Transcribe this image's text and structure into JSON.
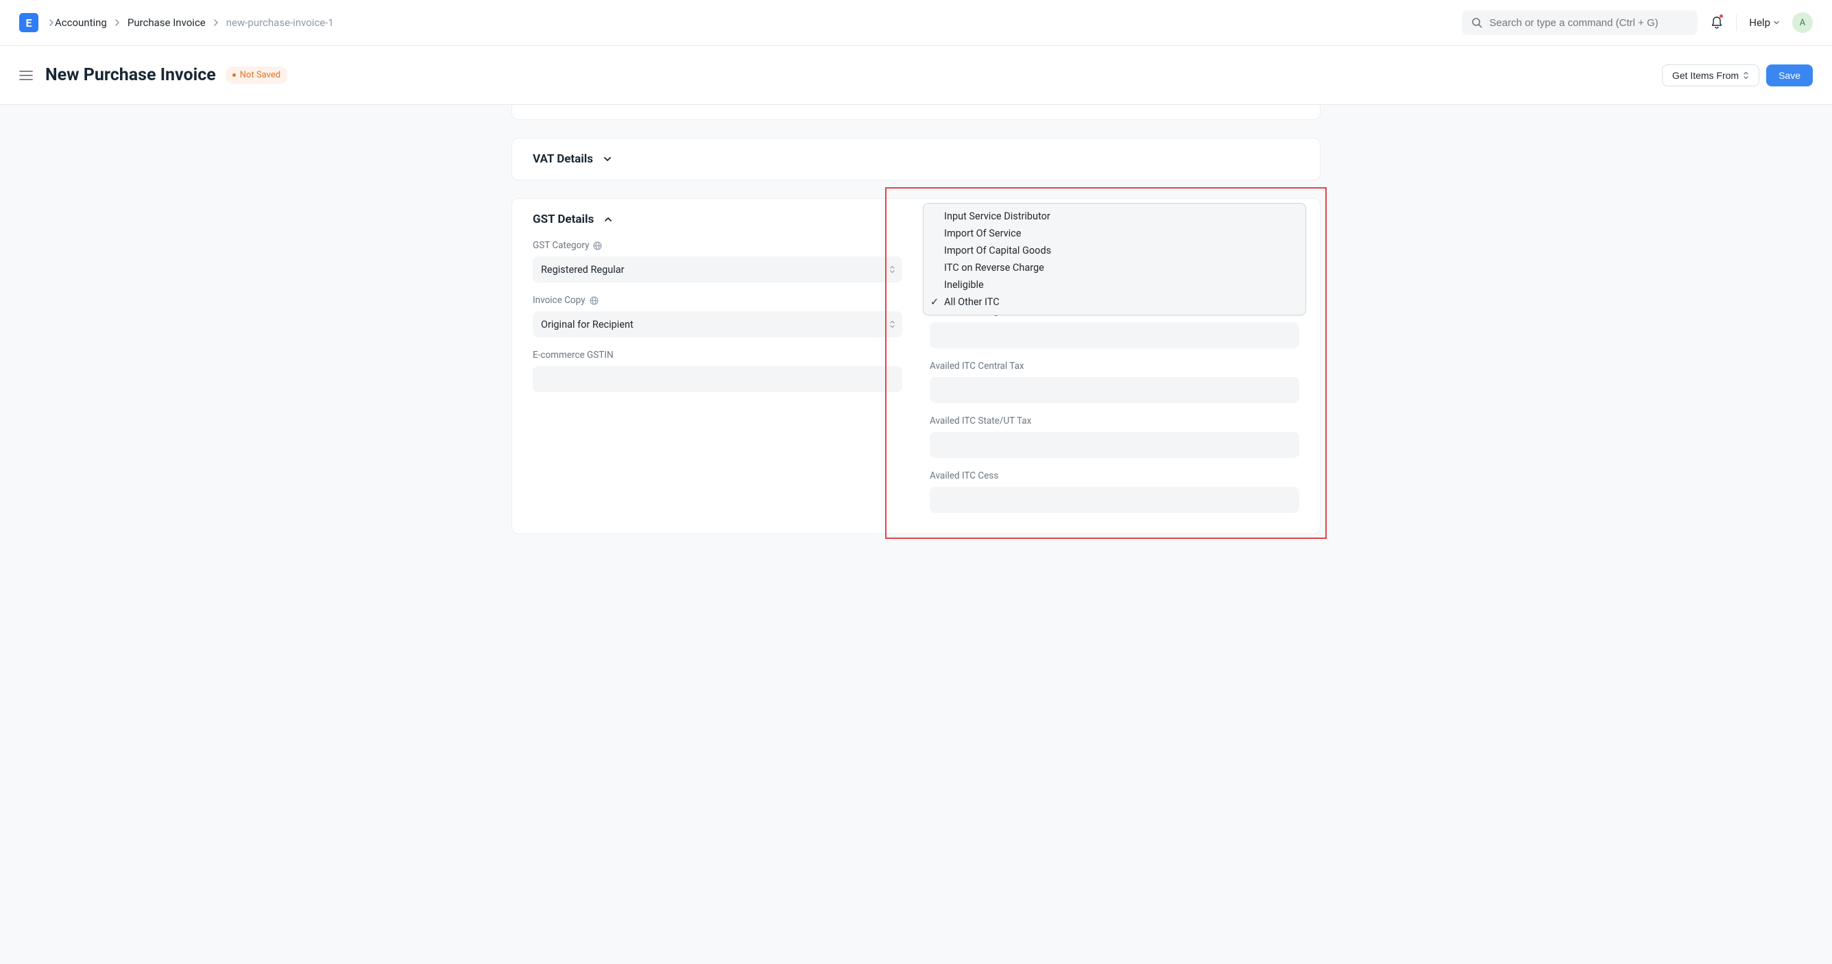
{
  "breadcrumbs": {
    "root": "Accounting",
    "mid": "Purchase Invoice",
    "current": "new-purchase-invoice-1"
  },
  "search": {
    "placeholder": "Search or type a command (Ctrl + G)"
  },
  "help_label": "Help",
  "avatar_letter": "A",
  "page": {
    "title": "New Purchase Invoice",
    "status": "Not Saved",
    "get_items_label": "Get Items From",
    "save_label": "Save"
  },
  "sections": {
    "vat": {
      "title": "VAT Details"
    },
    "gst": {
      "title": "GST Details"
    }
  },
  "gst": {
    "category_label": "GST Category",
    "category_value": "Registered Regular",
    "invoice_copy_label": "Invoice Copy",
    "invoice_copy_value": "Original for Recipient",
    "ecommerce_label": "E-commerce GSTIN",
    "ecommerce_value": "",
    "itc_integrated_label": "Availed ITC Integrated Tax",
    "itc_integrated_value": "",
    "itc_central_label": "Availed ITC Central Tax",
    "itc_central_value": "",
    "itc_state_label": "Availed ITC State/UT Tax",
    "itc_state_value": "",
    "itc_cess_label": "Availed ITC Cess",
    "itc_cess_value": ""
  },
  "dropdown": {
    "options": [
      "Input Service Distributor",
      "Import Of Service",
      "Import Of Capital Goods",
      "ITC on Reverse Charge",
      "Ineligible",
      "All Other ITC"
    ],
    "selected": "All Other ITC"
  },
  "logo_letter": "E"
}
